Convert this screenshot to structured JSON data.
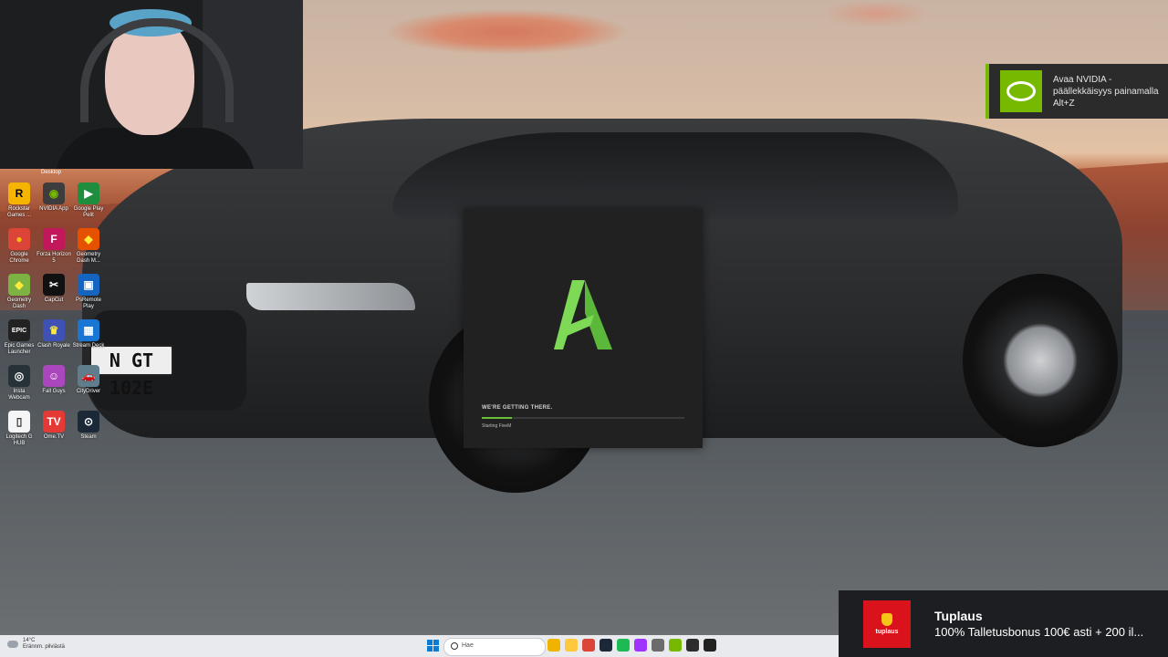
{
  "webcam": {
    "label": "streamer webcam"
  },
  "desktop": {
    "label_partial": "Desktop",
    "icons": [
      {
        "label": "Rockstar Games ...",
        "glyph": "R",
        "color": "#f4b400",
        "text_color": "#000"
      },
      {
        "label": "NVIDIA App",
        "glyph": "◉",
        "color": "#3d3d3d",
        "text_color": "#76b900"
      },
      {
        "label": "Google Play Pelit",
        "glyph": "▶",
        "color": "#1e8e3e",
        "text_color": "#fff"
      },
      {
        "label": "Google Chrome",
        "glyph": "●",
        "color": "#db4437",
        "text_color": "#f4c20d"
      },
      {
        "label": "Forza Horizon 5",
        "glyph": "F",
        "color": "#c2185b",
        "text_color": "#fff"
      },
      {
        "label": "Geometry Dash M...",
        "glyph": "◆",
        "color": "#e65100",
        "text_color": "#ffeb3b"
      },
      {
        "label": "Geometry Dash",
        "glyph": "◆",
        "color": "#7cb342",
        "text_color": "#ffeb3b"
      },
      {
        "label": "CapCut",
        "glyph": "✂",
        "color": "#111",
        "text_color": "#fff"
      },
      {
        "label": "PsRemote Play",
        "glyph": "▣",
        "color": "#1565c0",
        "text_color": "#fff"
      },
      {
        "label": "Epic Games Launcher",
        "glyph": "EPIC",
        "color": "#222",
        "text_color": "#fff"
      },
      {
        "label": "Clash Royale",
        "glyph": "♛",
        "color": "#3f51b5",
        "text_color": "#ffeb3b"
      },
      {
        "label": "Stream Deck",
        "glyph": "▦",
        "color": "#1976d2",
        "text_color": "#fff"
      },
      {
        "label": "Insta Webcam",
        "glyph": "◎",
        "color": "#263238",
        "text_color": "#fff"
      },
      {
        "label": "Fall Guys",
        "glyph": "☺",
        "color": "#ab47bc",
        "text_color": "#fff"
      },
      {
        "label": "CityDriver",
        "glyph": "🚗",
        "color": "#607d8b",
        "text_color": "#fff"
      },
      {
        "label": "Logitech G HUB",
        "glyph": "▯",
        "color": "#f5f5f5",
        "text_color": "#333"
      },
      {
        "label": "Ome.TV",
        "glyph": "TV",
        "color": "#e53935",
        "text_color": "#fff"
      },
      {
        "label": "Steam",
        "glyph": "⊙",
        "color": "#1b2838",
        "text_color": "#fff"
      }
    ]
  },
  "wallpaper": {
    "plate_text": "N GT 102E"
  },
  "nvidia_toast": {
    "text": "Avaa NVIDIA -päällekkäisyys painamalla Alt+Z",
    "accent": "#76b900"
  },
  "fivem_splash": {
    "title": "WE'RE GETTING THERE.",
    "status": "Starting FiveM",
    "progress": 0.15,
    "accent": "#6abf3a"
  },
  "ad": {
    "brand": "tuplaus",
    "title": "Tuplaus",
    "description": "100% Talletusbonus 100€ asti + 200 il..."
  },
  "taskbar": {
    "weather_temp": "14°C",
    "weather_desc": "Erännm. pilviästä",
    "search_placeholder": "Hae",
    "pinned_apps": [
      {
        "name": "file-explorer-app",
        "color": "#f0b400"
      },
      {
        "name": "folder-app",
        "color": "#ffc83d"
      },
      {
        "name": "chrome-app",
        "color": "#db4437"
      },
      {
        "name": "steam-app",
        "color": "#1b2838"
      },
      {
        "name": "spotify-app",
        "color": "#1db954"
      },
      {
        "name": "messenger-app",
        "color": "#a033ff"
      },
      {
        "name": "settings-app",
        "color": "#6b6b6b"
      },
      {
        "name": "nvidia-app",
        "color": "#76b900"
      },
      {
        "name": "terminal-app",
        "color": "#2d2d2d"
      },
      {
        "name": "fivem-app",
        "color": "#222"
      }
    ]
  }
}
